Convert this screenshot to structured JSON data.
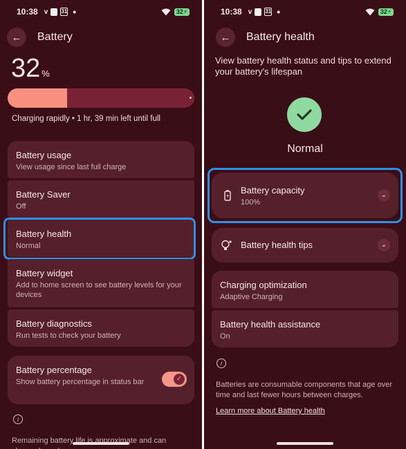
{
  "status_bar": {
    "time": "10:38",
    "carrier_glyph": "v",
    "calendar_glyph": "31",
    "battery_level": "32"
  },
  "left": {
    "title": "Battery",
    "level_value": "32",
    "level_unit": "%",
    "level_fraction": 0.32,
    "charging_text": "Charging rapidly • 1 hr, 39 min left until full",
    "items": [
      {
        "title": "Battery usage",
        "subtitle": "View usage since last full charge"
      },
      {
        "title": "Battery Saver",
        "subtitle": "Off"
      },
      {
        "title": "Battery health",
        "subtitle": "Normal"
      },
      {
        "title": "Battery widget",
        "subtitle": "Add to home screen to see battery levels for your devices"
      },
      {
        "title": "Battery diagnostics",
        "subtitle": "Run tests to check your battery"
      }
    ],
    "percentage_setting": {
      "title": "Battery percentage",
      "subtitle": "Show battery percentage in status bar",
      "enabled": true
    },
    "footer": "Remaining battery life is approximate and can change based on usage"
  },
  "right": {
    "title": "Battery health",
    "intro": "View battery health status and tips to extend your battery's lifespan",
    "health_status": "Normal",
    "capacity": {
      "title": "Battery capacity",
      "value": "100%"
    },
    "tips": {
      "title": "Battery health tips"
    },
    "optimization": {
      "title": "Charging optimization",
      "subtitle": "Adaptive Charging"
    },
    "assistance": {
      "title": "Battery health assistance",
      "subtitle": "On"
    },
    "footer": "Batteries are consumable components that age over time and last fewer hours between charges.",
    "link": "Learn more about Battery health"
  },
  "colors": {
    "background": "#3a0e16",
    "card": "#55202b",
    "accent": "#f8907f",
    "highlight": "#2f8fe6",
    "healthy": "#8ed9a0"
  }
}
